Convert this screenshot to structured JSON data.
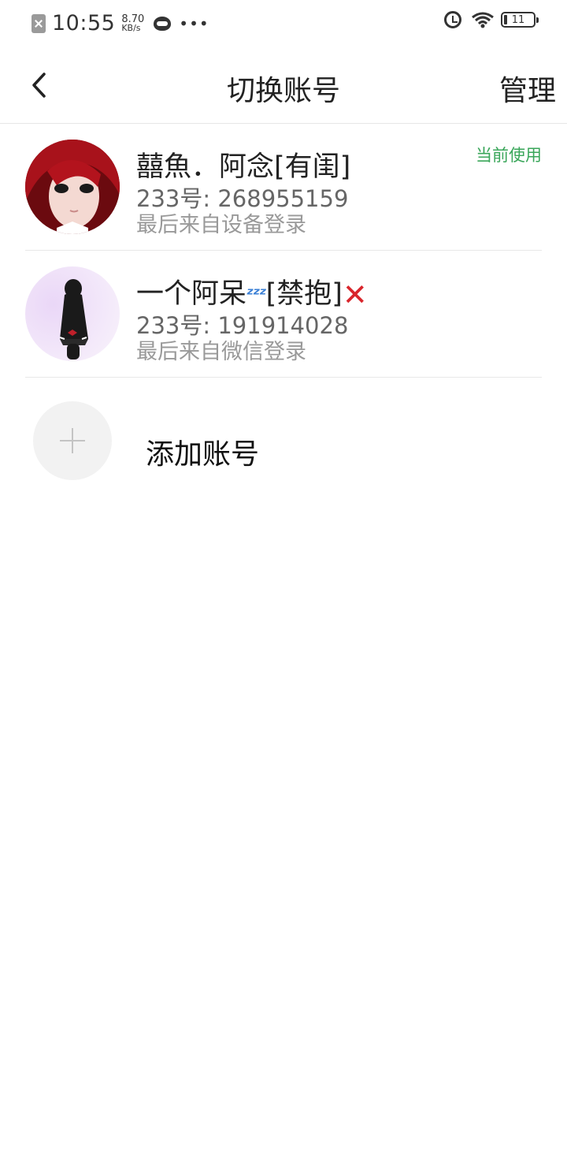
{
  "status_bar": {
    "time": "10:55",
    "net_speed_value": "8.70",
    "net_speed_unit": "KB/s",
    "battery": "11",
    "icons": [
      "no-sim-icon",
      "cat-app-icon",
      "more-dots-icon",
      "alarm-icon",
      "wifi-icon",
      "battery-icon"
    ]
  },
  "header": {
    "title": "切换账号",
    "manage_label": "管理",
    "back_icon": "chevron-left-icon"
  },
  "accounts": [
    {
      "name": "囍魚．阿念[有闺]",
      "id": "233号: 268955159",
      "login": "最后来自设备登录",
      "tag": "当前使用"
    },
    {
      "name_prefix": "一个阿呆",
      "name_emoji_zzz": "ᶻᶻᶻ",
      "name_suffix": "[禁抱]",
      "name_emoji_x": "✕",
      "id": "233号: 191914028",
      "login": "最后来自微信登录"
    }
  ],
  "add_account": {
    "label": "添加账号",
    "icon": "plus-icon"
  },
  "colors": {
    "current_tag": "#3aa65a",
    "divider": "#e8e8e8",
    "add_circle_bg": "#f2f2f2"
  }
}
